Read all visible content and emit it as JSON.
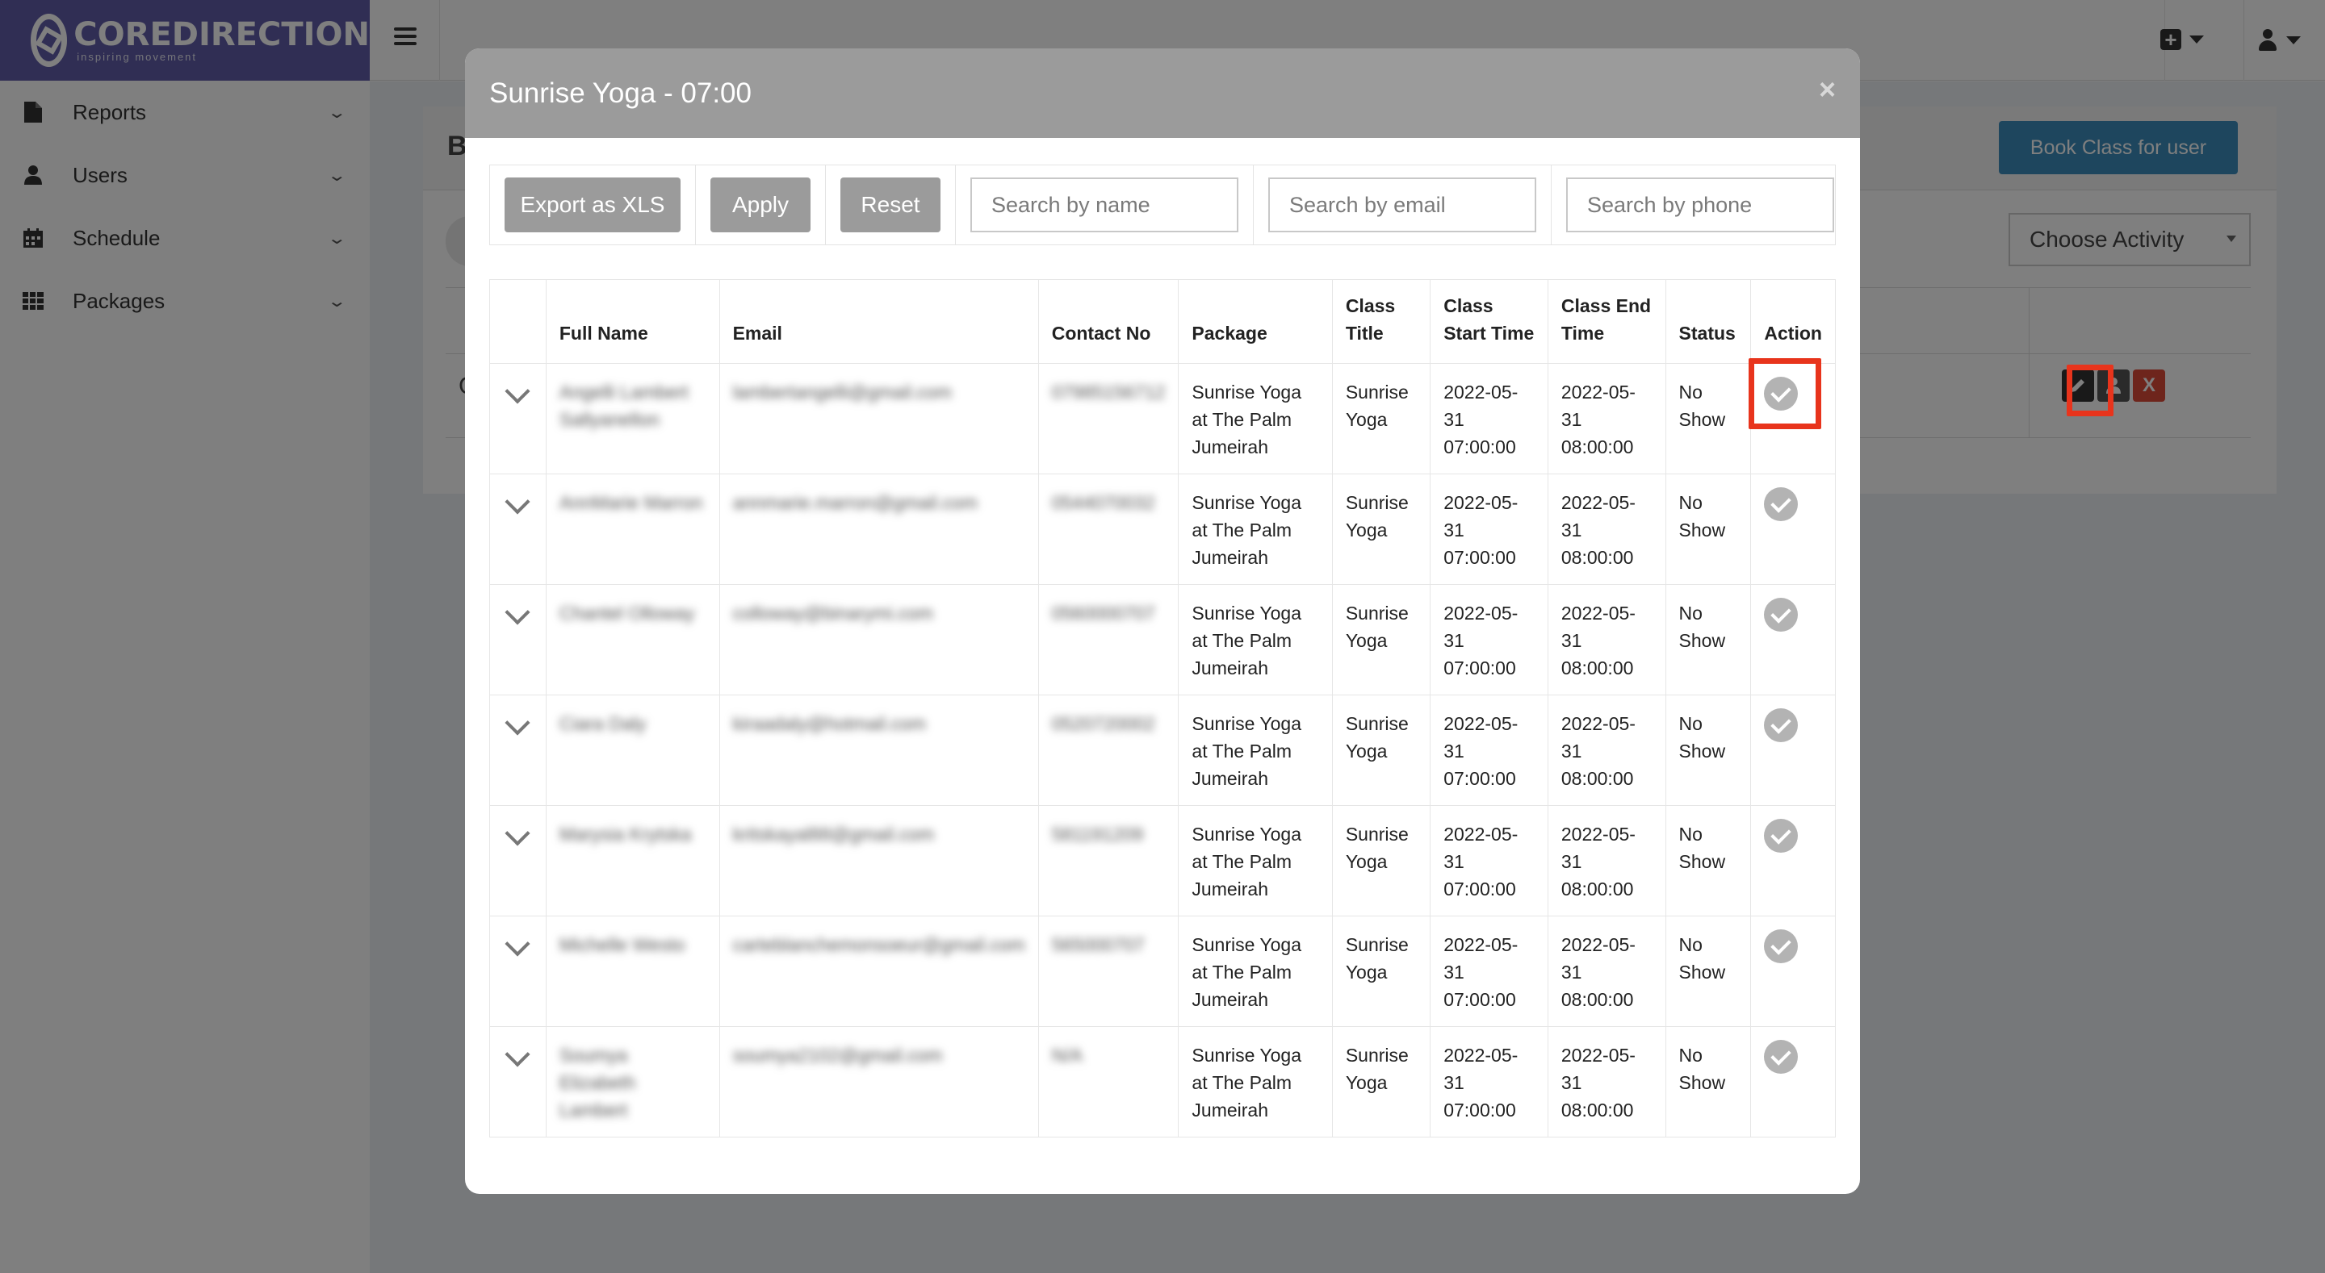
{
  "brand": {
    "name": "COREDIRECTION",
    "tagline": "inspiring movement"
  },
  "sidebar": {
    "items": [
      {
        "label": "Reports",
        "icon": "file-icon"
      },
      {
        "label": "Users",
        "icon": "user-icon"
      },
      {
        "label": "Schedule",
        "icon": "calendar-icon"
      },
      {
        "label": "Packages",
        "icon": "grid-icon"
      }
    ]
  },
  "background": {
    "box_title": "B",
    "book_button": "Book Class for user",
    "choose_activity": "Choose Activity",
    "row_initial": "C",
    "delete_label": "X"
  },
  "modal": {
    "title": "Sunrise Yoga - 07:00",
    "close": "×",
    "filters": {
      "export_label": "Export as XLS",
      "apply_label": "Apply",
      "reset_label": "Reset",
      "name_placeholder": "Search by name",
      "email_placeholder": "Search by email",
      "phone_placeholder": "Search by phone"
    },
    "columns": [
      "Full Name",
      "Email",
      "Contact No",
      "Package",
      "Class Title",
      "Class Start Time",
      "Class End Time",
      "Status",
      "Action"
    ],
    "rows": [
      {
        "name": "Angelli Lambert Sallyanellon",
        "email": "lambertangelli@gmail.com",
        "phone": "07985156712",
        "package": "Sunrise Yoga at The Palm Jumeirah",
        "class_title": "Sunrise Yoga",
        "start": "2022-05-31 07:00:00",
        "end": "2022-05-31 08:00:00",
        "status": "No Show"
      },
      {
        "name": "AnnMarie Marron",
        "email": "annmarie.marron@gmail.com",
        "phone": "0544070032",
        "package": "Sunrise Yoga at The Palm Jumeirah",
        "class_title": "Sunrise Yoga",
        "start": "2022-05-31 07:00:00",
        "end": "2022-05-31 08:00:00",
        "status": "No Show"
      },
      {
        "name": "Chantel Olloway",
        "email": "colloway@binarymi.com",
        "phone": "0560000707",
        "package": "Sunrise Yoga at The Palm Jumeirah",
        "class_title": "Sunrise Yoga",
        "start": "2022-05-31 07:00:00",
        "end": "2022-05-31 08:00:00",
        "status": "No Show"
      },
      {
        "name": "Ciara Daly",
        "email": "kiraadaly@hotmail.com",
        "phone": "0520720002",
        "package": "Sunrise Yoga at The Palm Jumeirah",
        "class_title": "Sunrise Yoga",
        "start": "2022-05-31 07:00:00",
        "end": "2022-05-31 08:00:00",
        "status": "No Show"
      },
      {
        "name": "Marysia Krytska",
        "email": "kritskayal88@gmail.com",
        "phone": "581191209",
        "package": "Sunrise Yoga at The Palm Jumeirah",
        "class_title": "Sunrise Yoga",
        "start": "2022-05-31 07:00:00",
        "end": "2022-05-31 08:00:00",
        "status": "No Show"
      },
      {
        "name": "Michelle Westo",
        "email": "carteblanchemonsoeur@gmail.com",
        "phone": "565000707",
        "package": "Sunrise Yoga at The Palm Jumeirah",
        "class_title": "Sunrise Yoga",
        "start": "2022-05-31 07:00:00",
        "end": "2022-05-31 08:00:00",
        "status": "No Show"
      },
      {
        "name": "Soumya Elizabeth Lambert",
        "email": "soumya2102@gmail.com",
        "phone": "N/A",
        "package": "Sunrise Yoga at The Palm Jumeirah",
        "class_title": "Sunrise Yoga",
        "start": "2022-05-31 07:00:00",
        "end": "2022-05-31 08:00:00",
        "status": "No Show"
      }
    ]
  },
  "colors": {
    "brand": "#605ca8",
    "modal_header": "#9b9b9b",
    "highlight": "#e8341c",
    "book_button": "#3c8dbc"
  }
}
